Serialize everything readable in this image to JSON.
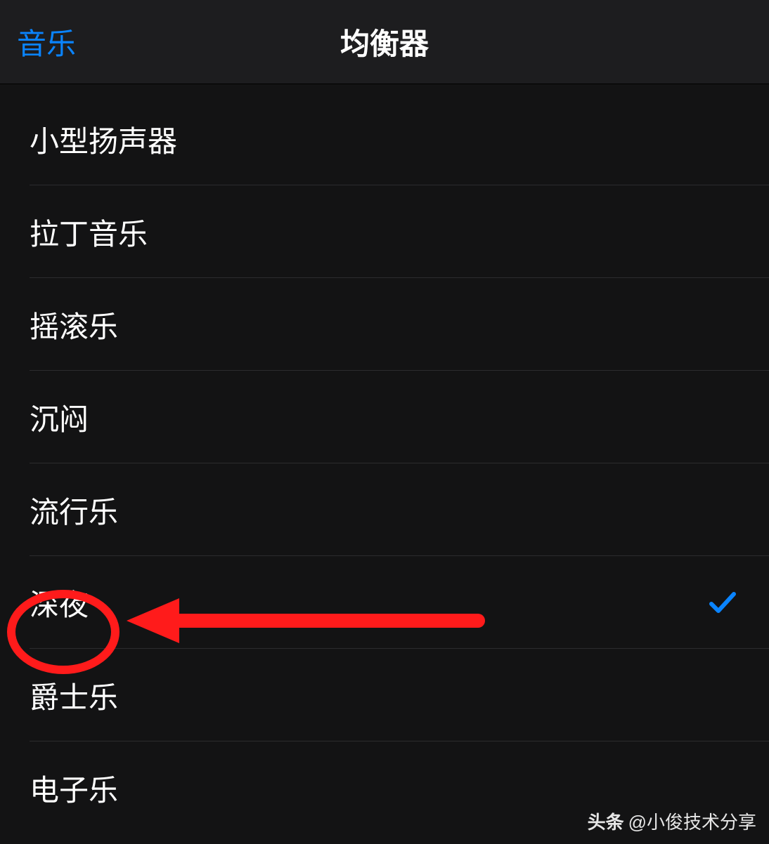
{
  "header": {
    "back_label": "音乐",
    "title": "均衡器"
  },
  "rows": [
    {
      "label": "小型扬声器",
      "selected": false
    },
    {
      "label": "拉丁音乐",
      "selected": false
    },
    {
      "label": "摇滚乐",
      "selected": false
    },
    {
      "label": "沉闷",
      "selected": false
    },
    {
      "label": "流行乐",
      "selected": false
    },
    {
      "label": "深夜",
      "selected": true
    },
    {
      "label": "爵士乐",
      "selected": false
    },
    {
      "label": "电子乐",
      "selected": false
    }
  ],
  "colors": {
    "accent_blue": "#0a84ff",
    "annotation_red": "#ff1b1b",
    "background": "#131314",
    "navbar_bg": "#1d1d1f",
    "separator": "#2c2c2e"
  },
  "annotation": {
    "circled_row_index": 5,
    "arrow_points_to_index": 5
  },
  "watermark": {
    "prefix": "头条",
    "suffix": "@小俊技术分享"
  }
}
